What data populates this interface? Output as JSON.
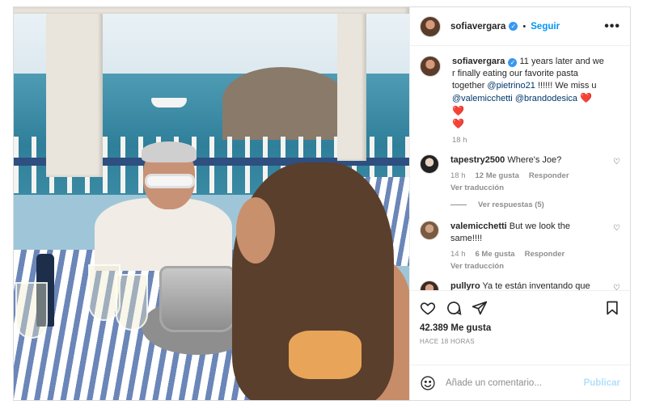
{
  "post": {
    "author": "sofiavergara",
    "follow_label": "Seguir",
    "dot": "•",
    "more_label": "•••"
  },
  "caption": {
    "username": "sofiavergara",
    "text_before": " 11 years later and we r finally eating our favorite pasta together ",
    "mention1": "@pietrino21",
    "text_mid": " !!!!!! We miss u ",
    "mention2": "@valemicchetti",
    "mention3": "@brandodesica",
    "hearts": "❤️ ❤️",
    "heart_last": "❤️",
    "time": "18 h"
  },
  "comments": [
    {
      "username": "tapestry2500",
      "text": "Where's Joe?",
      "time": "18 h",
      "likes": "12 Me gusta",
      "reply": "Responder",
      "translate": "Ver traducción",
      "replies": "Ver respuestas (5)"
    },
    {
      "username": "valemicchetti",
      "text": "But we look the same!!!!",
      "time": "14 h",
      "likes": "6 Me gusta",
      "reply": "Responder",
      "translate": "Ver traducción"
    },
    {
      "username": "pullyro",
      "text": "Ya te están inventando que"
    }
  ],
  "actions": {
    "likes_count": "42.389 Me gusta",
    "time_ago": "HACE 18 HORAS"
  },
  "add_comment": {
    "placeholder": "Añade un comentario...",
    "publish_label": "Publicar"
  },
  "colors": {
    "link_blue": "#0095f6",
    "heart_red": "#ed4956",
    "verified_blue": "#3897f0"
  }
}
